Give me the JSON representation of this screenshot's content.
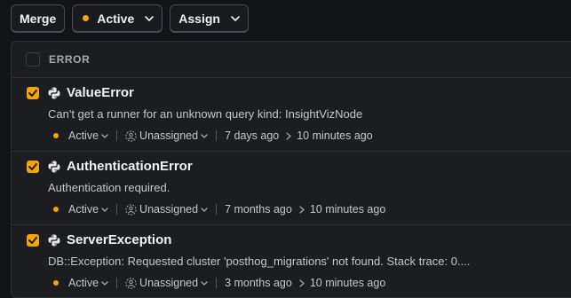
{
  "toolbar": {
    "merge_label": "Merge",
    "status_label": "Active",
    "assign_label": "Assign"
  },
  "list_header": {
    "title": "ERROR"
  },
  "issues": [
    {
      "title": "ValueError",
      "description": "Can't get a runner for an unknown query kind: InsightVizNode",
      "status": "Active",
      "assignee": "Unassigned",
      "first_seen": "7 days ago",
      "last_seen": "10 minutes ago"
    },
    {
      "title": "AuthenticationError",
      "description": "Authentication required.",
      "status": "Active",
      "assignee": "Unassigned",
      "first_seen": "7 months ago",
      "last_seen": "10 minutes ago"
    },
    {
      "title": "ServerException",
      "description": "DB::Exception: Requested cluster 'posthog_migrations' not found. Stack trace: 0....",
      "status": "Active",
      "assignee": "Unassigned",
      "first_seen": "3 months ago",
      "last_seen": "10 minutes ago"
    }
  ],
  "icons": {
    "language": "python-icon",
    "checkbox": "checkmark-icon",
    "assignee": "unassigned-user-icon",
    "time_arrow": "chevron-right-icon",
    "dropdown": "chevron-down-icon"
  },
  "colors": {
    "accent": "#f7a501",
    "background": "#131417",
    "panel": "#1c1d21",
    "border": "#2e2f34"
  }
}
